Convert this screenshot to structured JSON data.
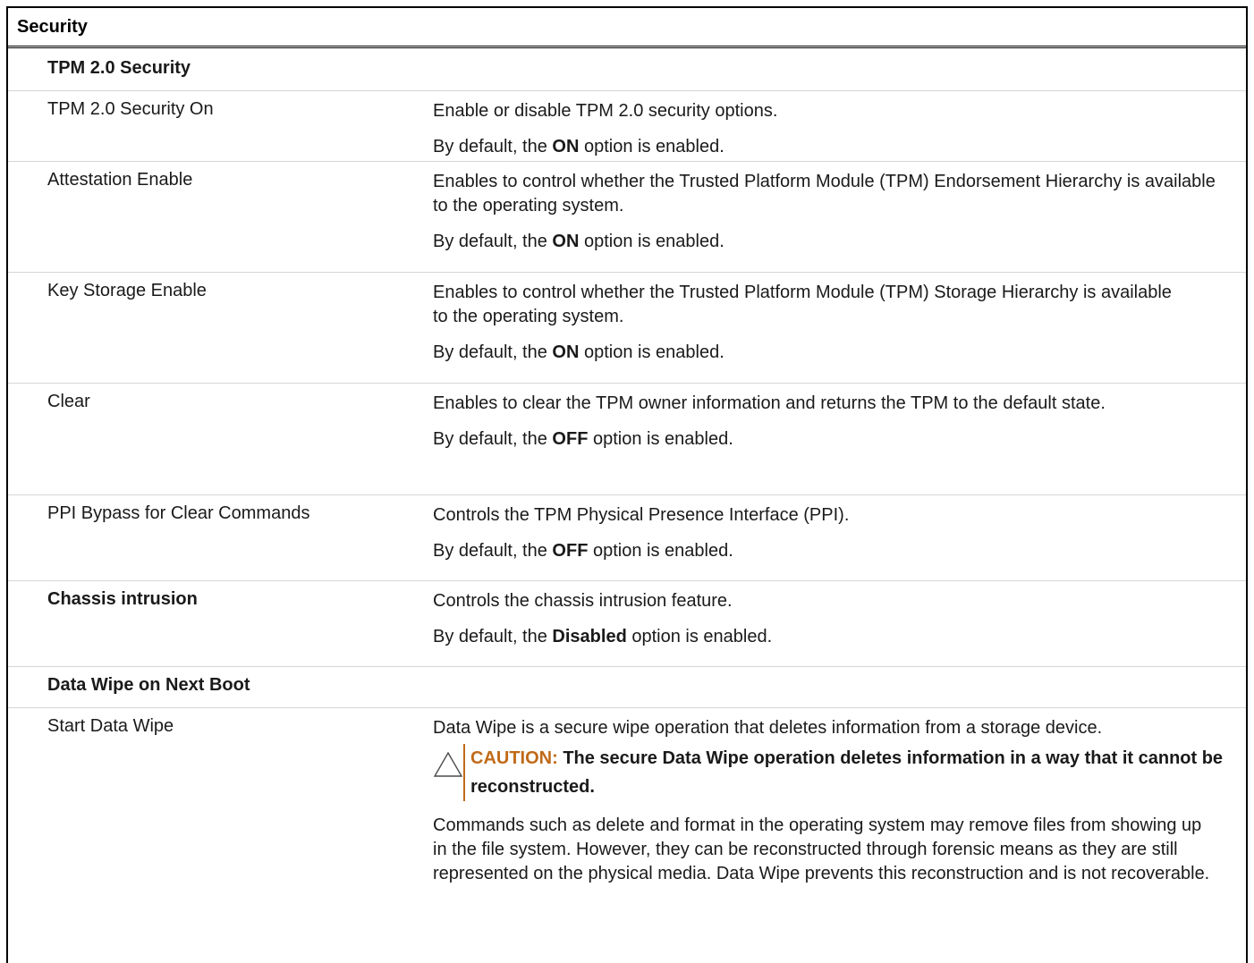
{
  "table_title": "Security",
  "sections": {
    "tpm": {
      "heading": "TPM 2.0 Security",
      "rows": [
        {
          "label": "TPM 2.0 Security On",
          "desc": "Enable or disable TPM 2.0 security options.",
          "default_pre": "By default, the ",
          "default_value": "ON",
          "default_post": " option is enabled."
        },
        {
          "label": "Attestation Enable",
          "desc": "Enables to control whether the Trusted Platform Module (TPM) Endorsement Hierarchy is available to the operating system.",
          "default_pre": "By default, the ",
          "default_value": "ON",
          "default_post": " option is enabled."
        },
        {
          "label": "Key Storage Enable",
          "desc": "Enables to control whether the Trusted Platform Module (TPM) Storage Hierarchy is available to the operating system.",
          "default_pre": "By default, the ",
          "default_value": "ON",
          "default_post": " option is enabled."
        },
        {
          "label": "Clear",
          "desc": "Enables to clear the TPM owner information and returns the TPM to the default state.",
          "default_pre": "By default, the ",
          "default_value": "OFF",
          "default_post": " option is enabled."
        },
        {
          "label": "PPI Bypass for Clear Commands",
          "desc": "Controls the TPM Physical Presence Interface (PPI).",
          "default_pre": "By default, the ",
          "default_value": "OFF",
          "default_post": " option is enabled."
        }
      ]
    },
    "chassis": {
      "label": "Chassis intrusion",
      "desc": "Controls the chassis intrusion feature.",
      "default_pre": "By default, the ",
      "default_value": "Disabled",
      "default_post": " option is enabled."
    },
    "data_wipe": {
      "heading": "Data Wipe on Next Boot",
      "label": "Start Data Wipe",
      "desc": "Data Wipe is a secure wipe operation that deletes information from a storage device.",
      "caution_label": "CAUTION:",
      "caution_text": " The secure Data Wipe operation deletes information in a way that it cannot be reconstructed.",
      "note": "Commands such as delete and format in the operating system may remove files from showing up in the file system. However, they can be reconstructed through forensic means as they are still represented on the physical media. Data Wipe prevents this reconstruction and is not recoverable."
    }
  },
  "icons": {
    "caution": "warning-triangle-icon"
  },
  "colors": {
    "caution_accent": "#c06a19",
    "divider": "#d6d6d6"
  }
}
